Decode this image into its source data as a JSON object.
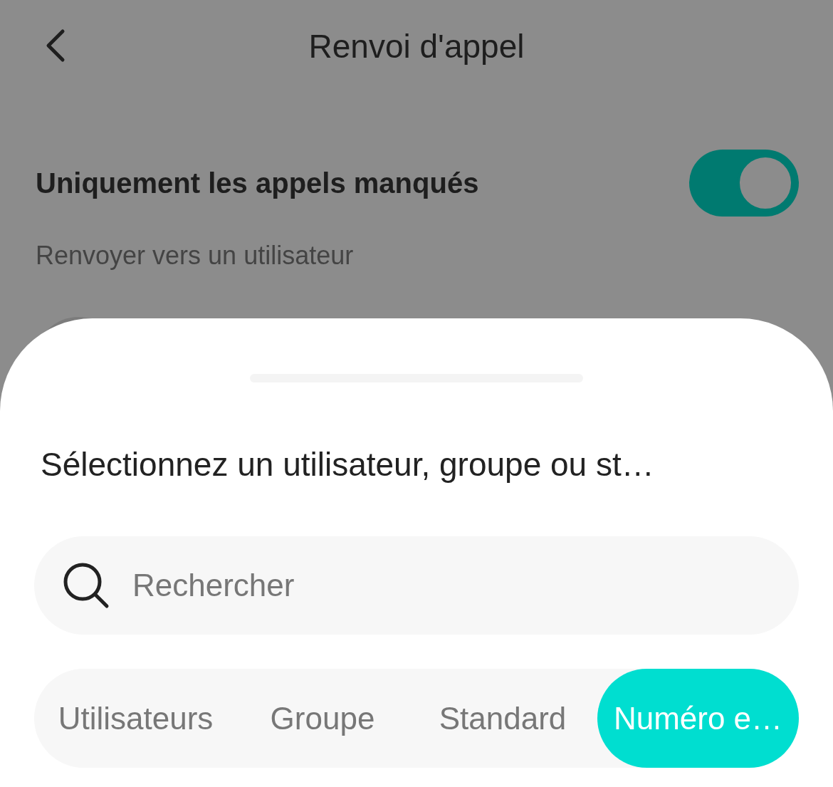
{
  "header": {
    "title": "Renvoi d'appel"
  },
  "missed_calls_only": {
    "label": "Uniquement les appels manqués",
    "on": true
  },
  "section_label": "Renvoyer vers un utilisateur",
  "sheet": {
    "title": "Sélectionnez un utilisateur, groupe ou st…",
    "search": {
      "placeholder": "Rechercher"
    },
    "tabs": [
      {
        "label": "Utilisateurs",
        "selected": false
      },
      {
        "label": "Groupe",
        "selected": false
      },
      {
        "label": "Standard",
        "selected": false
      },
      {
        "label": "Numéro e…",
        "selected": true
      }
    ]
  }
}
